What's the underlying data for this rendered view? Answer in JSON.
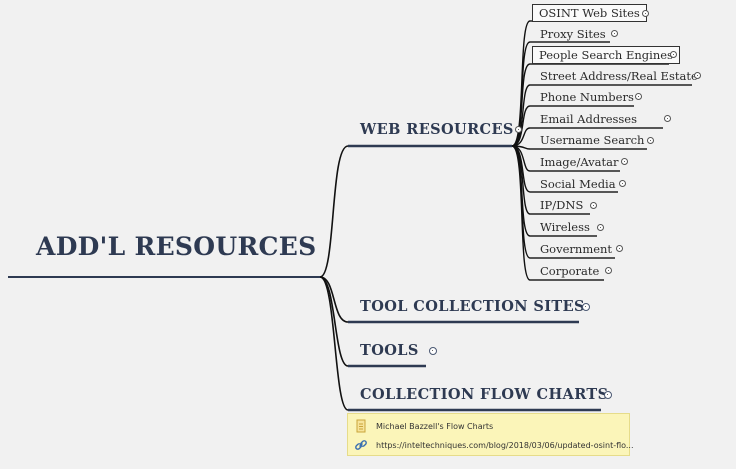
{
  "root": {
    "title": "ADD'L RESOURCES"
  },
  "branches": [
    {
      "label": "WEB RESOURCES"
    },
    {
      "label": "TOOL COLLECTION SITES"
    },
    {
      "label": "TOOLS"
    },
    {
      "label": "COLLECTION FLOW CHARTS"
    }
  ],
  "web_resources": [
    {
      "label": "OSINT Web Sites"
    },
    {
      "label": "Proxy Sites"
    },
    {
      "label": "People Search Engines"
    },
    {
      "label": "Street Address/Real Estate"
    },
    {
      "label": "Phone Numbers"
    },
    {
      "label": "Email Addresses"
    },
    {
      "label": "Username Search"
    },
    {
      "label": "Image/Avatar"
    },
    {
      "label": "Social Media"
    },
    {
      "label": "IP/DNS"
    },
    {
      "label": "Wireless"
    },
    {
      "label": "Government"
    },
    {
      "label": "Corporate"
    }
  ],
  "note": {
    "title": "Michael Bazzell's Flow Charts",
    "link": "https://inteltechniques.com/blog/2018/03/06/updated-osint-flo..."
  },
  "colors": {
    "branch_line": "#2e3a52",
    "connector": "#111111",
    "note_bg": "#fbf5b9"
  },
  "icons": {
    "note": "document-icon",
    "link": "link-icon",
    "toggle": "collapse-toggle-icon"
  }
}
